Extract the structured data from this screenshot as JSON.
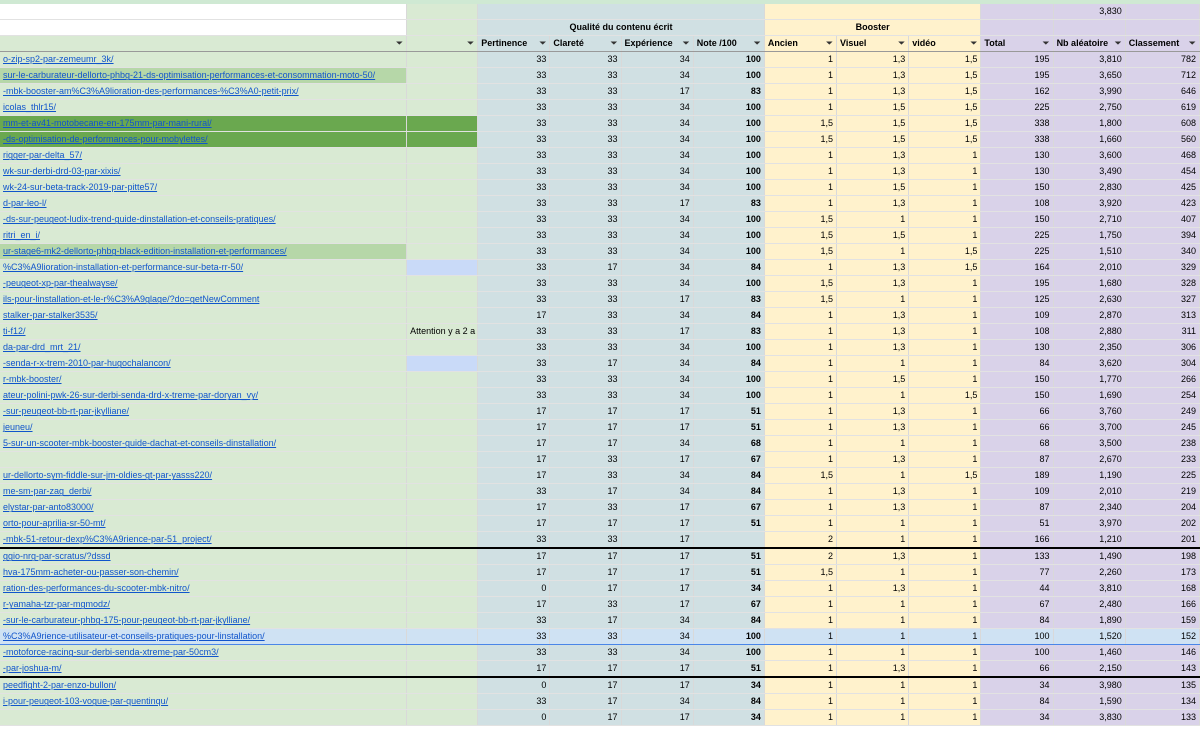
{
  "header": {
    "top_value": "3,830",
    "group_quality": "Qualité du contenu écrit",
    "group_booster": "Booster",
    "columns": [
      "Pertinence",
      "Clareté",
      "Expérience",
      "Note /100",
      "Ancien",
      "Visuel",
      "vidéo",
      "Total",
      "Nb aléatoire",
      "Classement"
    ],
    "filter_icon": "filter-icon"
  },
  "rows": [
    {
      "url": "o-zip-sp2-par-zemeumr_3k/",
      "note": "",
      "p": "33",
      "c": "33",
      "e": "34",
      "n": "100",
      "a": "1",
      "v": "1,3",
      "vi": "1,5",
      "t": "195",
      "r": "3,810",
      "k": "782",
      "cls": "partial"
    },
    {
      "url": "sur-le-carburateur-dellorto-phbg-21-ds-optimisation-performances-et-consommation-moto-50/",
      "note": "",
      "p": "33",
      "c": "33",
      "e": "34",
      "n": "100",
      "a": "1",
      "v": "1,3",
      "vi": "1,5",
      "t": "195",
      "r": "3,650",
      "k": "712",
      "cls": "g-light"
    },
    {
      "url": "-mbk-booster-am%C3%A9lioration-des-performances-%C3%A0-petit-prix/",
      "note": "",
      "p": "33",
      "c": "33",
      "e": "17",
      "n": "83",
      "a": "1",
      "v": "1,3",
      "vi": "1,5",
      "t": "162",
      "r": "3,990",
      "k": "646",
      "cls": ""
    },
    {
      "url": "icolas_thlr15/",
      "note": "",
      "p": "33",
      "c": "33",
      "e": "34",
      "n": "100",
      "a": "1",
      "v": "1,5",
      "vi": "1,5",
      "t": "225",
      "r": "2,750",
      "k": "619",
      "cls": ""
    },
    {
      "url": "mm-et-av41-motobecane-en-175mm-par-mani-rural/",
      "note": "",
      "p": "33",
      "c": "33",
      "e": "34",
      "n": "100",
      "a": "1,5",
      "v": "1,5",
      "vi": "1,5",
      "t": "338",
      "r": "1,800",
      "k": "608",
      "cls": "g-dark"
    },
    {
      "url": "-ds-optimisation-de-performances-pour-mobylettes/",
      "note": "",
      "p": "33",
      "c": "33",
      "e": "34",
      "n": "100",
      "a": "1,5",
      "v": "1,5",
      "vi": "1,5",
      "t": "338",
      "r": "1,660",
      "k": "560",
      "cls": "g-dark"
    },
    {
      "url": "rigger-par-delta_57/",
      "note": "",
      "p": "33",
      "c": "33",
      "e": "34",
      "n": "100",
      "a": "1",
      "v": "1,3",
      "vi": "1",
      "t": "130",
      "r": "3,600",
      "k": "468",
      "cls": ""
    },
    {
      "url": "wk-sur-derbi-drd-03-par-xixis/",
      "note": "",
      "p": "33",
      "c": "33",
      "e": "34",
      "n": "100",
      "a": "1",
      "v": "1,3",
      "vi": "1",
      "t": "130",
      "r": "3,490",
      "k": "454",
      "cls": ""
    },
    {
      "url": "wk-24-sur-beta-track-2019-par-pitte57/",
      "note": "",
      "p": "33",
      "c": "33",
      "e": "34",
      "n": "100",
      "a": "1",
      "v": "1,5",
      "vi": "1",
      "t": "150",
      "r": "2,830",
      "k": "425",
      "cls": ""
    },
    {
      "url": "d-par-leo-l/",
      "note": "",
      "p": "33",
      "c": "33",
      "e": "17",
      "n": "83",
      "a": "1",
      "v": "1,3",
      "vi": "1",
      "t": "108",
      "r": "3,920",
      "k": "423",
      "cls": ""
    },
    {
      "url": "-ds-sur-peugeot-ludix-trend-guide-dinstallation-et-conseils-pratiques/",
      "note": "",
      "p": "33",
      "c": "33",
      "e": "34",
      "n": "100",
      "a": "1,5",
      "v": "1",
      "vi": "1",
      "t": "150",
      "r": "2,710",
      "k": "407",
      "cls": ""
    },
    {
      "url": "ritri_en_i/",
      "note": "",
      "p": "33",
      "c": "33",
      "e": "34",
      "n": "100",
      "a": "1,5",
      "v": "1,5",
      "vi": "1",
      "t": "225",
      "r": "1,750",
      "k": "394",
      "cls": ""
    },
    {
      "url": "ur-stage6-mk2-dellorto-phbg-black-edition-installation-et-performances/",
      "note": "",
      "p": "33",
      "c": "33",
      "e": "34",
      "n": "100",
      "a": "1,5",
      "v": "1",
      "vi": "1,5",
      "t": "225",
      "r": "1,510",
      "k": "340",
      "cls": "g-light"
    },
    {
      "url": "%C3%A9lioration-installation-et-performance-sur-beta-rr-50/",
      "note": "",
      "p": "33",
      "c": "17",
      "e": "34",
      "n": "84",
      "a": "1",
      "v": "1,3",
      "vi": "1,5",
      "t": "164",
      "r": "2,010",
      "k": "329",
      "cls": "",
      "gray": true
    },
    {
      "url": "-peugeot-xp-par-thealwayse/",
      "note": "",
      "p": "33",
      "c": "33",
      "e": "34",
      "n": "100",
      "a": "1,5",
      "v": "1,3",
      "vi": "1",
      "t": "195",
      "r": "1,680",
      "k": "328",
      "cls": ""
    },
    {
      "url": "ils-pour-linstallation-et-le-r%C3%A9glage/?do=getNewComment",
      "note": "",
      "p": "33",
      "c": "33",
      "e": "17",
      "n": "83",
      "a": "1,5",
      "v": "1",
      "vi": "1",
      "t": "125",
      "r": "2,630",
      "k": "327",
      "cls": ""
    },
    {
      "url": "stalker-par-stalker3535/",
      "note": "",
      "p": "17",
      "c": "33",
      "e": "34",
      "n": "84",
      "a": "1",
      "v": "1,3",
      "vi": "1",
      "t": "109",
      "r": "2,870",
      "k": "313",
      "cls": ""
    },
    {
      "url": "ti-f12/",
      "note": "Attention y a 2 a",
      "p": "33",
      "c": "33",
      "e": "17",
      "n": "83",
      "a": "1",
      "v": "1,3",
      "vi": "1",
      "t": "108",
      "r": "2,880",
      "k": "311",
      "cls": ""
    },
    {
      "url": "da-par-drd_mrt_21/",
      "note": "",
      "p": "33",
      "c": "33",
      "e": "34",
      "n": "100",
      "a": "1",
      "v": "1,3",
      "vi": "1",
      "t": "130",
      "r": "2,350",
      "k": "306",
      "cls": ""
    },
    {
      "url": "-senda-r-x-trem-2010-par-hugochalancon/",
      "note": "",
      "p": "33",
      "c": "17",
      "e": "34",
      "n": "84",
      "a": "1",
      "v": "1",
      "vi": "1",
      "t": "84",
      "r": "3,620",
      "k": "304",
      "cls": "",
      "gray": true
    },
    {
      "url": "r-mbk-booster/",
      "note": "",
      "p": "33",
      "c": "33",
      "e": "34",
      "n": "100",
      "a": "1",
      "v": "1,5",
      "vi": "1",
      "t": "150",
      "r": "1,770",
      "k": "266",
      "cls": ""
    },
    {
      "url": "ateur-polini-pwk-26-sur-derbi-senda-drd-x-treme-par-doryan_vy/",
      "note": "",
      "p": "33",
      "c": "33",
      "e": "34",
      "n": "100",
      "a": "1",
      "v": "1",
      "vi": "1,5",
      "t": "150",
      "r": "1,690",
      "k": "254",
      "cls": ""
    },
    {
      "url": "-sur-peugeot-bb-rt-par-jkylliane/",
      "note": "",
      "p": "17",
      "c": "17",
      "e": "17",
      "n": "51",
      "a": "1",
      "v": "1,3",
      "vi": "1",
      "t": "66",
      "r": "3,760",
      "k": "249",
      "cls": ""
    },
    {
      "url": "jeuneu/",
      "note": "",
      "p": "17",
      "c": "17",
      "e": "17",
      "n": "51",
      "a": "1",
      "v": "1,3",
      "vi": "1",
      "t": "66",
      "r": "3,700",
      "k": "245",
      "cls": ""
    },
    {
      "url": "5-sur-un-scooter-mbk-booster-guide-dachat-et-conseils-dinstallation/",
      "note": "",
      "p": "17",
      "c": "17",
      "e": "34",
      "n": "68",
      "a": "1",
      "v": "1",
      "vi": "1",
      "t": "68",
      "r": "3,500",
      "k": "238",
      "cls": ""
    },
    {
      "url": "",
      "note": "",
      "p": "17",
      "c": "33",
      "e": "17",
      "n": "67",
      "a": "1",
      "v": "1,3",
      "vi": "1",
      "t": "87",
      "r": "2,670",
      "k": "233",
      "cls": ""
    },
    {
      "url": "ur-dellorto-sym-fiddle-sur-jm-oldies-gt-par-yasss220/",
      "note": "",
      "p": "17",
      "c": "33",
      "e": "34",
      "n": "84",
      "a": "1,5",
      "v": "1",
      "vi": "1,5",
      "t": "189",
      "r": "1,190",
      "k": "225",
      "cls": ""
    },
    {
      "url": "me-sm-par-zag_derbi/",
      "note": "",
      "p": "33",
      "c": "17",
      "e": "34",
      "n": "84",
      "a": "1",
      "v": "1,3",
      "vi": "1",
      "t": "109",
      "r": "2,010",
      "k": "219",
      "cls": ""
    },
    {
      "url": "elystar-par-anto83000/",
      "note": "",
      "p": "17",
      "c": "33",
      "e": "17",
      "n": "67",
      "a": "1",
      "v": "1,3",
      "vi": "1",
      "t": "87",
      "r": "2,340",
      "k": "204",
      "cls": ""
    },
    {
      "url": "orto-pour-aprilia-sr-50-mt/",
      "note": "",
      "p": "17",
      "c": "17",
      "e": "17",
      "n": "51",
      "a": "1",
      "v": "1",
      "vi": "1",
      "t": "51",
      "r": "3,970",
      "k": "202",
      "cls": ""
    },
    {
      "url": "-mbk-51-retour-dexp%C3%A9rience-par-51_project/",
      "note": "",
      "p": "33",
      "c": "33",
      "e": "17",
      "n": "",
      "a": "2",
      "v": "1",
      "vi": "1",
      "t": "166",
      "r": "1,210",
      "k": "201",
      "cls": ""
    },
    {
      "url": "ggio-nrg-par-scratus/?dssd",
      "note": "",
      "p": "17",
      "c": "17",
      "e": "17",
      "n": "51",
      "a": "2",
      "v": "1,3",
      "vi": "1",
      "t": "133",
      "r": "1,490",
      "k": "198",
      "cls": "thick"
    },
    {
      "url": "hva-175mm-acheter-ou-passer-son-chemin/",
      "note": "",
      "p": "17",
      "c": "17",
      "e": "17",
      "n": "51",
      "a": "1,5",
      "v": "1",
      "vi": "1",
      "t": "77",
      "r": "2,260",
      "k": "173",
      "cls": ""
    },
    {
      "url": "ration-des-performances-du-scooter-mbk-nitro/",
      "note": "",
      "p": "0",
      "c": "17",
      "e": "17",
      "n": "34",
      "a": "1",
      "v": "1,3",
      "vi": "1",
      "t": "44",
      "r": "3,810",
      "k": "168",
      "cls": ""
    },
    {
      "url": "r-yamaha-tzr-par-mgmodz/",
      "note": "",
      "p": "17",
      "c": "33",
      "e": "17",
      "n": "67",
      "a": "1",
      "v": "1",
      "vi": "1",
      "t": "67",
      "r": "2,480",
      "k": "166",
      "cls": ""
    },
    {
      "url": "-sur-le-carburateur-phbg-175-pour-peugeot-bb-rt-par-jkylliane/",
      "note": "",
      "p": "33",
      "c": "17",
      "e": "34",
      "n": "84",
      "a": "1",
      "v": "1",
      "vi": "1",
      "t": "84",
      "r": "1,890",
      "k": "159",
      "cls": ""
    },
    {
      "url": "%C3%A9rience-utilisateur-et-conseils-pratiques-pour-linstallation/",
      "note": "",
      "p": "33",
      "c": "33",
      "e": "34",
      "n": "100",
      "a": "1",
      "v": "1",
      "vi": "1",
      "t": "100",
      "r": "1,520",
      "k": "152",
      "cls": "sel"
    },
    {
      "url": "-motoforce-racing-sur-derbi-senda-xtreme-par-50cm3/",
      "note": "",
      "p": "33",
      "c": "33",
      "e": "34",
      "n": "100",
      "a": "1",
      "v": "1",
      "vi": "1",
      "t": "100",
      "r": "1,460",
      "k": "146",
      "cls": ""
    },
    {
      "url": "-par-joshua-m/",
      "note": "",
      "p": "17",
      "c": "17",
      "e": "17",
      "n": "51",
      "a": "1",
      "v": "1,3",
      "vi": "1",
      "t": "66",
      "r": "2,150",
      "k": "143",
      "cls": ""
    },
    {
      "url": "peedfight-2-par-enzo-bullon/",
      "note": "",
      "p": "0",
      "c": "17",
      "e": "17",
      "n": "34",
      "a": "1",
      "v": "1",
      "vi": "1",
      "t": "34",
      "r": "3,980",
      "k": "135",
      "cls": "thick"
    },
    {
      "url": "i-pour-peugeot-103-vogue-par-quentinqu/",
      "note": "",
      "p": "33",
      "c": "17",
      "e": "34",
      "n": "84",
      "a": "1",
      "v": "1",
      "vi": "1",
      "t": "84",
      "r": "1,590",
      "k": "134",
      "cls": ""
    },
    {
      "url": "",
      "note": "",
      "p": "0",
      "c": "17",
      "e": "17",
      "n": "34",
      "a": "1",
      "v": "1",
      "vi": "1",
      "t": "34",
      "r": "3,830",
      "k": "133",
      "cls": ""
    }
  ]
}
